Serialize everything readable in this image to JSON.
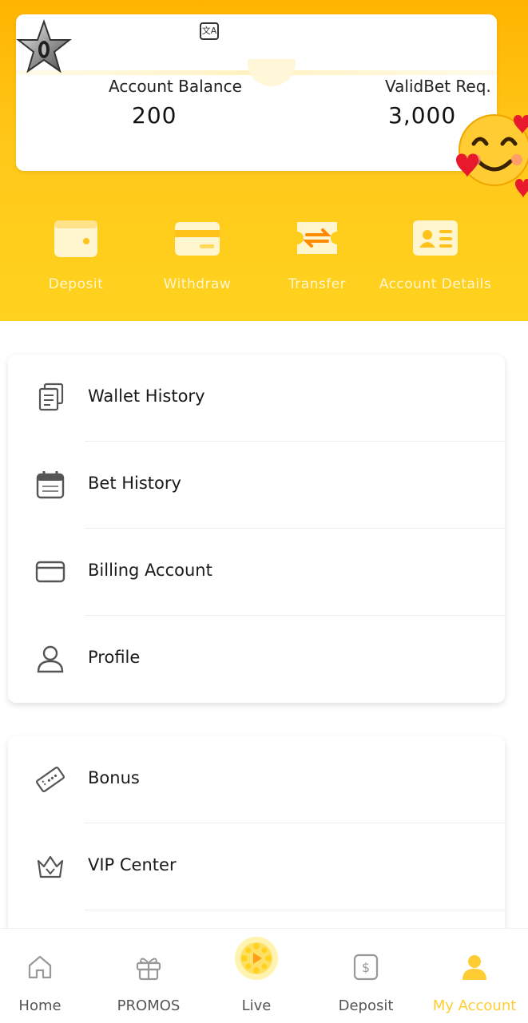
{
  "header": {
    "account_balance_label": "Account Balance",
    "account_balance_value": "200",
    "validbet_label": "ValidBet Req.",
    "validbet_value": "3,000",
    "language_icon_text": "文A"
  },
  "actions": [
    {
      "label": "Deposit",
      "icon": "wallet-icon"
    },
    {
      "label": "Withdraw",
      "icon": "card-icon"
    },
    {
      "label": "Transfer",
      "icon": "transfer-icon"
    },
    {
      "label": "Account Details",
      "icon": "id-card-icon"
    }
  ],
  "menu_group_1": [
    {
      "label": "Wallet History",
      "icon": "documents-icon"
    },
    {
      "label": "Bet History",
      "icon": "calendar-icon"
    },
    {
      "label": "Billing Account",
      "icon": "credit-card-icon"
    },
    {
      "label": "Profile",
      "icon": "user-icon"
    }
  ],
  "menu_group_2": [
    {
      "label": "Bonus",
      "icon": "ticket-icon"
    },
    {
      "label": "VIP Center",
      "icon": "crown-icon"
    }
  ],
  "bottom_nav": [
    {
      "label": "Home",
      "icon": "home-icon"
    },
    {
      "label": "PROMOS",
      "icon": "gift-icon"
    },
    {
      "label": "Live",
      "icon": "live-play-icon"
    },
    {
      "label": "Deposit",
      "icon": "dollar-icon"
    },
    {
      "label": "My Account",
      "icon": "person-icon",
      "active": true
    }
  ],
  "colors": {
    "header_top": "#ffb400",
    "header_bottom": "#ffd21e",
    "active_nav": "#ffcc33",
    "action_label": "#fff6cf"
  }
}
